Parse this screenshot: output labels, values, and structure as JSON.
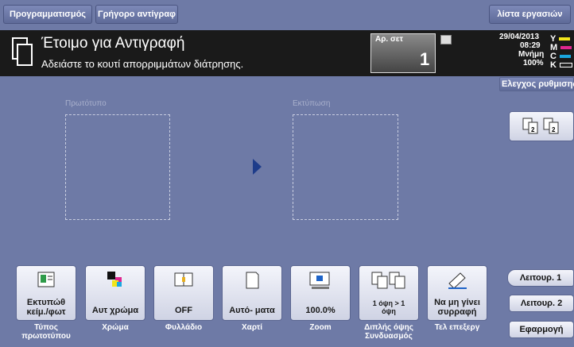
{
  "header": {
    "programming_label": "Προγραμματισμός",
    "quick_copy_label": "Γρήγορο αντίγραφ",
    "job_list_label": "λίστα εργασιών"
  },
  "status": {
    "title": "Έτοιμο για Αντιγραφή",
    "message": "Αδειάστε το κουτί απορριμμάτων διάτρησης.",
    "sets_label": "Αρ. σετ",
    "sets_value": "1",
    "date": "29/04/2013",
    "time": "08:29",
    "memory_label": "Μνήμη",
    "memory_value": "100%",
    "toners": [
      {
        "letter": "Y",
        "color": "#f2e51c"
      },
      {
        "letter": "M",
        "color": "#e0278f"
      },
      {
        "letter": "C",
        "color": "#1aa7e0"
      },
      {
        "letter": "K",
        "color": "#222222"
      }
    ]
  },
  "check_settings_label": "Ελεγχος ρυθμισης",
  "preview": {
    "original_label": "Πρωτότυπο",
    "output_label": "Εκτύπωση"
  },
  "functions": [
    {
      "value": "Εκτυπώθ κείμ./φωτ",
      "caption": "Τύπος πρωτοτύπου",
      "icon": "original-type-icon"
    },
    {
      "value": "Αυτ χρώμα",
      "caption": "Χρώμα",
      "icon": "color-icon"
    },
    {
      "value": "OFF",
      "caption": "Φυλλάδιο",
      "icon": "booklet-icon"
    },
    {
      "value": "Αυτό- ματα",
      "caption": "Χαρτί",
      "icon": "paper-icon"
    },
    {
      "value": "100.0%",
      "caption": "Zoom",
      "icon": "zoom-icon"
    },
    {
      "value": "1 όψη > 1 όψη",
      "caption": "Διπλής όψης Συνδυασμός",
      "icon": "duplex-icon"
    },
    {
      "value": "Να μη γίνει συρραφή",
      "caption": "Τελ επεξεργ",
      "icon": "finishing-icon"
    }
  ],
  "side": {
    "function1_label": "Λειτουρ. 1",
    "function2_label": "Λειτουρ. 2",
    "apply_label": "Εφαρμογή"
  }
}
